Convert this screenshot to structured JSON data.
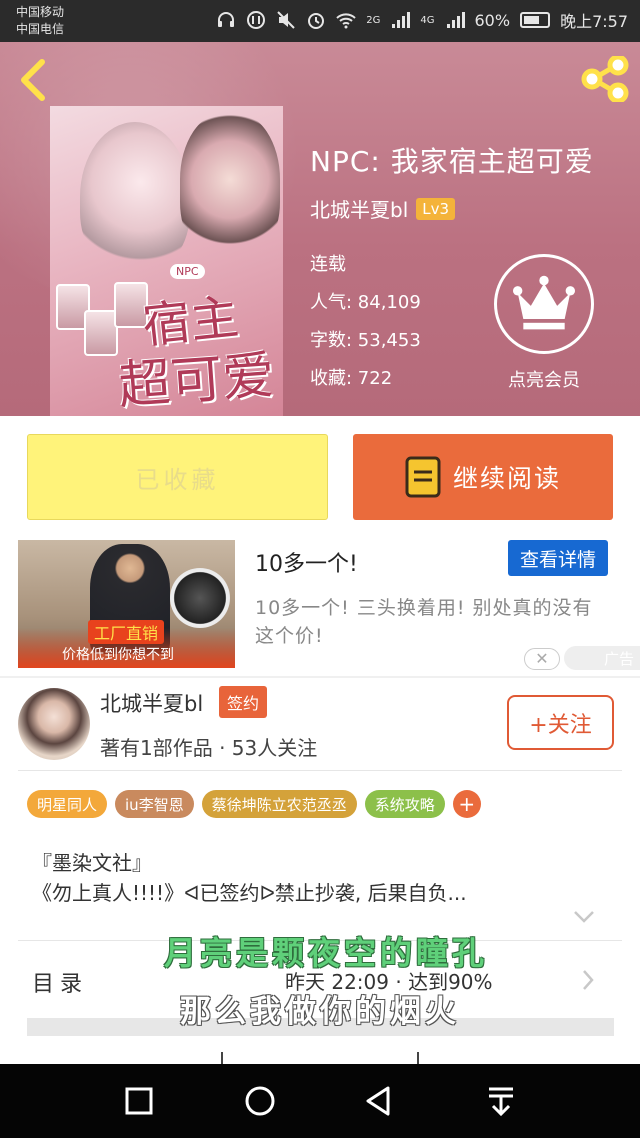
{
  "status_bar": {
    "carrier_1": "中国移动",
    "carrier_2": "中国电信",
    "net_1": "2G",
    "net_2": "4G",
    "battery": "60%",
    "time": "晚上7:57"
  },
  "book": {
    "title": "NPC: 我家宿主超可爱",
    "author": "北城半夏bl",
    "level": "Lv3",
    "status": "连载",
    "popularity": "人气: 84,109",
    "word_count": "字数: 53,453",
    "favorites": "收藏: 722",
    "membership_label": "点亮会员"
  },
  "actions": {
    "collected_label": "已收藏",
    "continue_label": "继续阅读"
  },
  "ad": {
    "headline": "10多一个!",
    "detail_button": "查看详情",
    "description": "10多一个! 三头换着用! 别处真的没有这个价!",
    "label": "广告",
    "image_tag_1": "工厂直销",
    "image_tag_2": "价格低到你想不到"
  },
  "author_card": {
    "name": "北城半夏bl",
    "badge": "签约",
    "stats": "著有1部作品 · 53人关注",
    "follow_button": "+关注"
  },
  "tags": [
    {
      "label": "明星同人",
      "color": "#f3a83a"
    },
    {
      "label": "iu李智恩",
      "color": "#c98a5e"
    },
    {
      "label": "蔡徐坤陈立农范丞丞",
      "color": "#d4a23a"
    },
    {
      "label": "系统攻略",
      "color": "#8cc04a"
    }
  ],
  "tag_more": "+",
  "description": {
    "line_1": "『墨染文社』",
    "line_2": "《勿上真人!!!!》ᐊ已签约ᐅ禁止抄袭, 后果自负..."
  },
  "catalog": {
    "label": "目录",
    "update": "昨天 22:09 · 达到90%"
  },
  "lyrics": {
    "line_1": "月亮是颗夜空的瞳孔",
    "line_2": "那么我做你的烟火"
  },
  "colors": {
    "header_bg": "#bb7181",
    "accent_orange": "#ea6b3c",
    "collect_yellow": "#fff37a",
    "ad_blue": "#1769d2"
  }
}
